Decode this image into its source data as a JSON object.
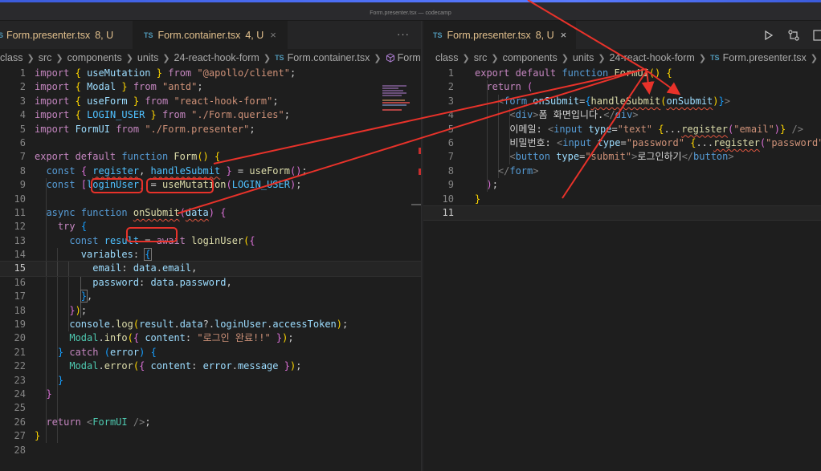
{
  "window": {
    "title": "Form.presenter.tsx — codecamp"
  },
  "colors": {
    "annotation": "#e8322a",
    "modified": "#e2c08d",
    "ts_badge": "#519aba",
    "editor_bg": "#1e1e1e"
  },
  "left_pane": {
    "tabs": [
      {
        "badge": "S",
        "name": "Form.presenter.tsx",
        "status": "8, U",
        "active": false
      },
      {
        "badge": "TS",
        "name": "Form.container.tsx",
        "status": "4, U",
        "active": true,
        "close": "×"
      }
    ],
    "more": "···",
    "breadcrumb": [
      "class",
      "src",
      "components",
      "units",
      "24-react-hook-form",
      "Form.container.tsx",
      "Form"
    ],
    "breadcrumb_file_badge": "TS",
    "current_line": 15
  },
  "right_pane": {
    "tabs": [
      {
        "badge": "TS",
        "name": "Form.presenter.tsx",
        "status": "8, U",
        "active": true,
        "close": "×"
      }
    ],
    "breadcrumb": [
      "class",
      "src",
      "components",
      "units",
      "24-react-hook-form",
      "Form.presenter.tsx",
      "..."
    ],
    "breadcrumb_file_badge": "TS",
    "actions": [
      "run-icon",
      "compare-changes-icon",
      "split-editor-icon"
    ]
  },
  "code_left": [
    {
      "n": "1",
      "t": "import { useMutation } from \"@apollo/client\";"
    },
    {
      "n": "2",
      "t": "import { Modal } from \"antd\";"
    },
    {
      "n": "3",
      "t": "import { useForm } from \"react-hook-form\";"
    },
    {
      "n": "4",
      "t": "import { LOGIN_USER } from \"./Form.queries\";"
    },
    {
      "n": "5",
      "t": "import FormUI from \"./Form.presenter\";"
    },
    {
      "n": "6",
      "t": ""
    },
    {
      "n": "7",
      "t": "export default function Form() {"
    },
    {
      "n": "8",
      "t": "  const { register, handleSubmit } = useForm();"
    },
    {
      "n": "9",
      "t": "  const [loginUser] = useMutation(LOGIN_USER);"
    },
    {
      "n": "10",
      "t": ""
    },
    {
      "n": "11",
      "t": "  async function onSubmit(data) {"
    },
    {
      "n": "12",
      "t": "    try {"
    },
    {
      "n": "13",
      "t": "      const result = await loginUser({"
    },
    {
      "n": "14",
      "t": "        variables: {"
    },
    {
      "n": "15",
      "t": "          email: data.email,"
    },
    {
      "n": "16",
      "t": "          password: data.password,"
    },
    {
      "n": "17",
      "t": "        },"
    },
    {
      "n": "18",
      "t": "      });"
    },
    {
      "n": "19",
      "t": "      console.log(result.data?.loginUser.accessToken);"
    },
    {
      "n": "20",
      "t": "      Modal.info({ content: \"로그인 완료!!\" });"
    },
    {
      "n": "21",
      "t": "    } catch (error) {"
    },
    {
      "n": "22",
      "t": "      Modal.error({ content: error.message });"
    },
    {
      "n": "23",
      "t": "    }"
    },
    {
      "n": "24",
      "t": "  }"
    },
    {
      "n": "25",
      "t": ""
    },
    {
      "n": "26",
      "t": "  return <FormUI />;"
    },
    {
      "n": "27",
      "t": "}"
    },
    {
      "n": "28",
      "t": ""
    }
  ],
  "code_right": [
    {
      "n": "1",
      "t": "export default function FormUI() {"
    },
    {
      "n": "2",
      "t": "  return ("
    },
    {
      "n": "3",
      "t": "    <form onSubmit={handleSubmit(onSubmit)}>"
    },
    {
      "n": "4",
      "t": "      <div>폼 화면입니다.</div>"
    },
    {
      "n": "5",
      "t": "      이메일: <input type=\"text\" {...register(\"email\")} />"
    },
    {
      "n": "6",
      "t": "      비밀번호: <input type=\"password\" {...register(\"password\")} />"
    },
    {
      "n": "7",
      "t": "      <button type=\"submit\">로그인하기</button>"
    },
    {
      "n": "8",
      "t": "    </form>"
    },
    {
      "n": "9",
      "t": "  );"
    },
    {
      "n": "10",
      "t": "}"
    },
    {
      "n": "11",
      "t": ""
    }
  ]
}
